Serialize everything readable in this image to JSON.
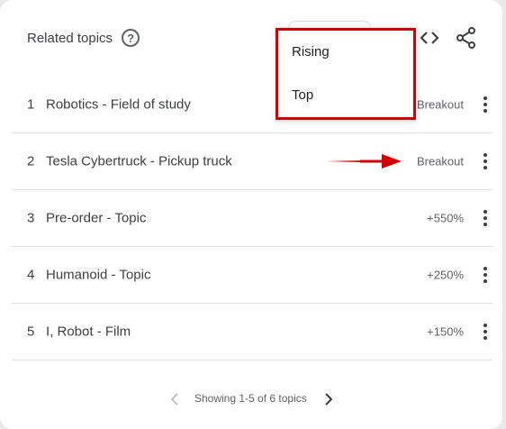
{
  "header": {
    "title": "Related topics",
    "help_icon": "?"
  },
  "dropdown": {
    "options": [
      "Rising",
      "Top"
    ]
  },
  "rows": [
    {
      "rank": "1",
      "label": "Robotics - Field of study",
      "value": "Breakout"
    },
    {
      "rank": "2",
      "label": "Tesla Cybertruck - Pickup truck",
      "value": "Breakout"
    },
    {
      "rank": "3",
      "label": "Pre-order - Topic",
      "value": "+550%"
    },
    {
      "rank": "4",
      "label": "Humanoid - Topic",
      "value": "+250%"
    },
    {
      "rank": "5",
      "label": "I, Robot - Film",
      "value": "+150%"
    }
  ],
  "pager": {
    "text": "Showing 1-5 of 6 topics"
  },
  "colors": {
    "highlight": "#d50000",
    "text": "#3c4043",
    "muted": "#5f6368"
  },
  "icons": [
    "help-icon",
    "embed-code-icon",
    "share-icon",
    "more-vert-icon",
    "arrow-annotation",
    "chevron-left-icon",
    "chevron-right-icon"
  ]
}
